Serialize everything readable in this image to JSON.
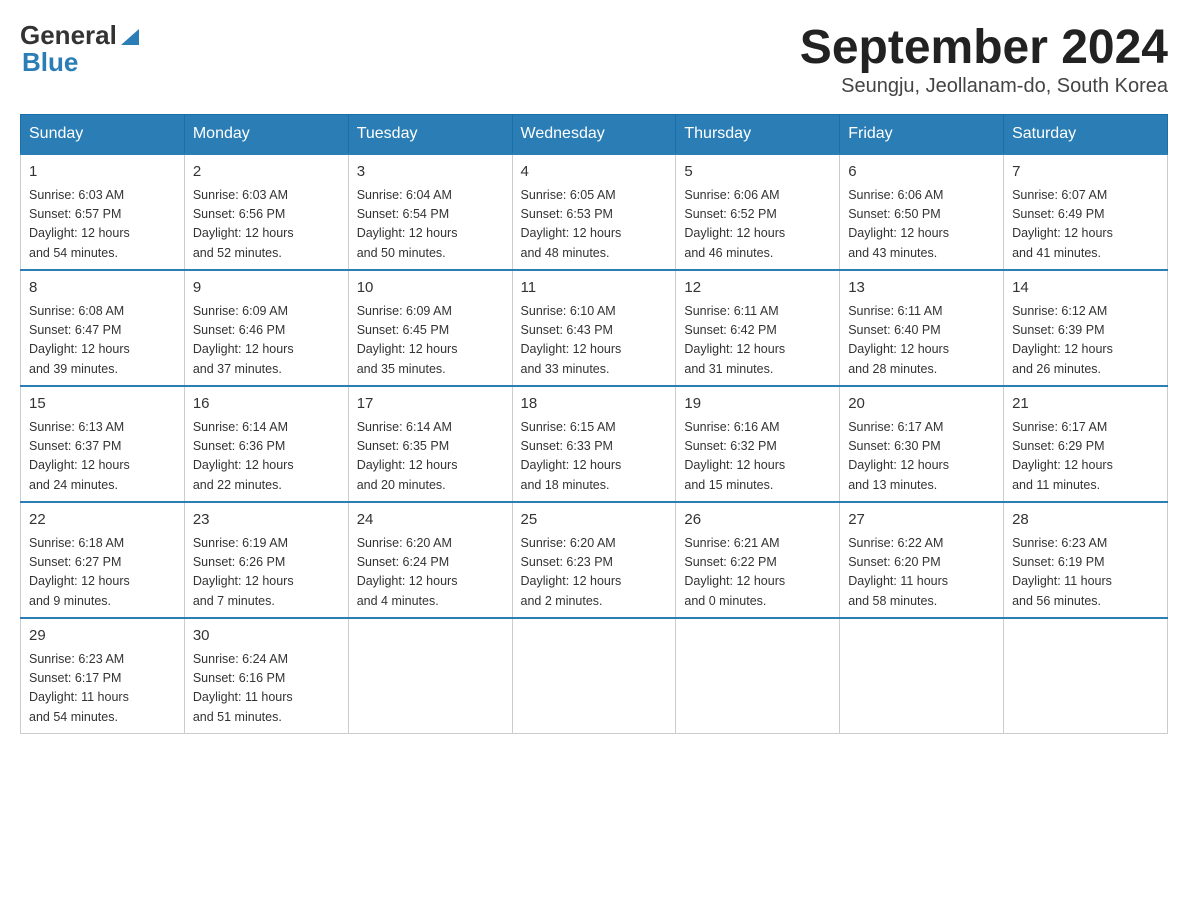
{
  "header": {
    "logo_general": "General",
    "logo_blue": "Blue",
    "month_title": "September 2024",
    "location": "Seungju, Jeollanam-do, South Korea"
  },
  "weekdays": [
    "Sunday",
    "Monday",
    "Tuesday",
    "Wednesday",
    "Thursday",
    "Friday",
    "Saturday"
  ],
  "weeks": [
    [
      {
        "day": "1",
        "sunrise": "6:03 AM",
        "sunset": "6:57 PM",
        "daylight": "12 hours and 54 minutes."
      },
      {
        "day": "2",
        "sunrise": "6:03 AM",
        "sunset": "6:56 PM",
        "daylight": "12 hours and 52 minutes."
      },
      {
        "day": "3",
        "sunrise": "6:04 AM",
        "sunset": "6:54 PM",
        "daylight": "12 hours and 50 minutes."
      },
      {
        "day": "4",
        "sunrise": "6:05 AM",
        "sunset": "6:53 PM",
        "daylight": "12 hours and 48 minutes."
      },
      {
        "day": "5",
        "sunrise": "6:06 AM",
        "sunset": "6:52 PM",
        "daylight": "12 hours and 46 minutes."
      },
      {
        "day": "6",
        "sunrise": "6:06 AM",
        "sunset": "6:50 PM",
        "daylight": "12 hours and 43 minutes."
      },
      {
        "day": "7",
        "sunrise": "6:07 AM",
        "sunset": "6:49 PM",
        "daylight": "12 hours and 41 minutes."
      }
    ],
    [
      {
        "day": "8",
        "sunrise": "6:08 AM",
        "sunset": "6:47 PM",
        "daylight": "12 hours and 39 minutes."
      },
      {
        "day": "9",
        "sunrise": "6:09 AM",
        "sunset": "6:46 PM",
        "daylight": "12 hours and 37 minutes."
      },
      {
        "day": "10",
        "sunrise": "6:09 AM",
        "sunset": "6:45 PM",
        "daylight": "12 hours and 35 minutes."
      },
      {
        "day": "11",
        "sunrise": "6:10 AM",
        "sunset": "6:43 PM",
        "daylight": "12 hours and 33 minutes."
      },
      {
        "day": "12",
        "sunrise": "6:11 AM",
        "sunset": "6:42 PM",
        "daylight": "12 hours and 31 minutes."
      },
      {
        "day": "13",
        "sunrise": "6:11 AM",
        "sunset": "6:40 PM",
        "daylight": "12 hours and 28 minutes."
      },
      {
        "day": "14",
        "sunrise": "6:12 AM",
        "sunset": "6:39 PM",
        "daylight": "12 hours and 26 minutes."
      }
    ],
    [
      {
        "day": "15",
        "sunrise": "6:13 AM",
        "sunset": "6:37 PM",
        "daylight": "12 hours and 24 minutes."
      },
      {
        "day": "16",
        "sunrise": "6:14 AM",
        "sunset": "6:36 PM",
        "daylight": "12 hours and 22 minutes."
      },
      {
        "day": "17",
        "sunrise": "6:14 AM",
        "sunset": "6:35 PM",
        "daylight": "12 hours and 20 minutes."
      },
      {
        "day": "18",
        "sunrise": "6:15 AM",
        "sunset": "6:33 PM",
        "daylight": "12 hours and 18 minutes."
      },
      {
        "day": "19",
        "sunrise": "6:16 AM",
        "sunset": "6:32 PM",
        "daylight": "12 hours and 15 minutes."
      },
      {
        "day": "20",
        "sunrise": "6:17 AM",
        "sunset": "6:30 PM",
        "daylight": "12 hours and 13 minutes."
      },
      {
        "day": "21",
        "sunrise": "6:17 AM",
        "sunset": "6:29 PM",
        "daylight": "12 hours and 11 minutes."
      }
    ],
    [
      {
        "day": "22",
        "sunrise": "6:18 AM",
        "sunset": "6:27 PM",
        "daylight": "12 hours and 9 minutes."
      },
      {
        "day": "23",
        "sunrise": "6:19 AM",
        "sunset": "6:26 PM",
        "daylight": "12 hours and 7 minutes."
      },
      {
        "day": "24",
        "sunrise": "6:20 AM",
        "sunset": "6:24 PM",
        "daylight": "12 hours and 4 minutes."
      },
      {
        "day": "25",
        "sunrise": "6:20 AM",
        "sunset": "6:23 PM",
        "daylight": "12 hours and 2 minutes."
      },
      {
        "day": "26",
        "sunrise": "6:21 AM",
        "sunset": "6:22 PM",
        "daylight": "12 hours and 0 minutes."
      },
      {
        "day": "27",
        "sunrise": "6:22 AM",
        "sunset": "6:20 PM",
        "daylight": "11 hours and 58 minutes."
      },
      {
        "day": "28",
        "sunrise": "6:23 AM",
        "sunset": "6:19 PM",
        "daylight": "11 hours and 56 minutes."
      }
    ],
    [
      {
        "day": "29",
        "sunrise": "6:23 AM",
        "sunset": "6:17 PM",
        "daylight": "11 hours and 54 minutes."
      },
      {
        "day": "30",
        "sunrise": "6:24 AM",
        "sunset": "6:16 PM",
        "daylight": "11 hours and 51 minutes."
      },
      null,
      null,
      null,
      null,
      null
    ]
  ],
  "labels": {
    "sunrise": "Sunrise:",
    "sunset": "Sunset:",
    "daylight": "Daylight:"
  }
}
